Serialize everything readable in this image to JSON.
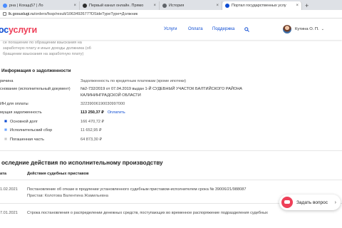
{
  "browser": {
    "tabs": [
      {
        "label": "рна | Кохщц57 | Ло",
        "color": "#4a8cff",
        "active": false
      },
      {
        "label": "Первый канал онлайн. Прямо",
        "color": "#2d2d2d",
        "active": false
      },
      {
        "label": "История",
        "color": "#5f6368",
        "active": false
      },
      {
        "label": "Портал государственных услу",
        "color": "#0d4cd3",
        "active": true
      }
    ],
    "url_host": "lk.gosuslugi.ru",
    "url_path": "/orders/fssp/result/1063492677?DSideTypeType=Должник"
  },
  "header": {
    "logo_part1": "ос",
    "logo_part2": "услуги",
    "nav": [
      "Услуги",
      "Оплата",
      "Поддержка"
    ],
    "search_icon": "search-icon",
    "user_name": "Кутина О. П.",
    "brand_blue": "#0d4cd3",
    "brand_red": "#ee3f58"
  },
  "intro_text": [
    "се погашение по обращении взыскания на",
    "заработную плату и иные доходы должника (об",
    "бращении взыскания на заработную плату)"
  ],
  "debt": {
    "title": "Информация о задолженности",
    "rows": [
      {
        "label": "ричина",
        "value": "Задолженность по кредитным платежам (кроме ипотеки)"
      },
      {
        "label": "снование (исполнительный документ)",
        "value": "№2-732/2019 от 07.04.2019 выдан 1-Й СУДЕБНЫЙ УЧАСТОК БАЛТИЙСКОГО РАЙОНА",
        "value2": "КАЛИНИНГРАДСКОЙ ОБЛАСТИ"
      },
      {
        "label": "ИН для оплаты",
        "value": "32239006190030997000"
      },
      {
        "label": "мущая задолженность",
        "value": "113 250,37 ₽",
        "link": "Оплатить"
      },
      {
        "label": "Основной долг",
        "value": "166 470,72 ₽"
      },
      {
        "label": "Исполнительский сбор",
        "value": "11 652,95 ₽"
      },
      {
        "label": "Погашенная часть",
        "value": "64 873,30 ₽"
      }
    ]
  },
  "actions": {
    "title": "оследние действия по исполнительному производству",
    "col_date": "ата",
    "col_action": "Действия судебных приставов",
    "items": [
      {
        "date": "1.02.2021",
        "text": "Постановление об отказе в продлении установленного судебным приставом-исполнителем срока № 39006/21/988087",
        "sub": "Пристав: Колотова Валентина Жамильевна"
      },
      {
        "date": "7.01.2021",
        "text": "Строка постановления о распределении денежных средств, поступающих во временное распоряжение подразделения судебных"
      }
    ]
  },
  "ask": {
    "label": "Задать вопрос"
  }
}
